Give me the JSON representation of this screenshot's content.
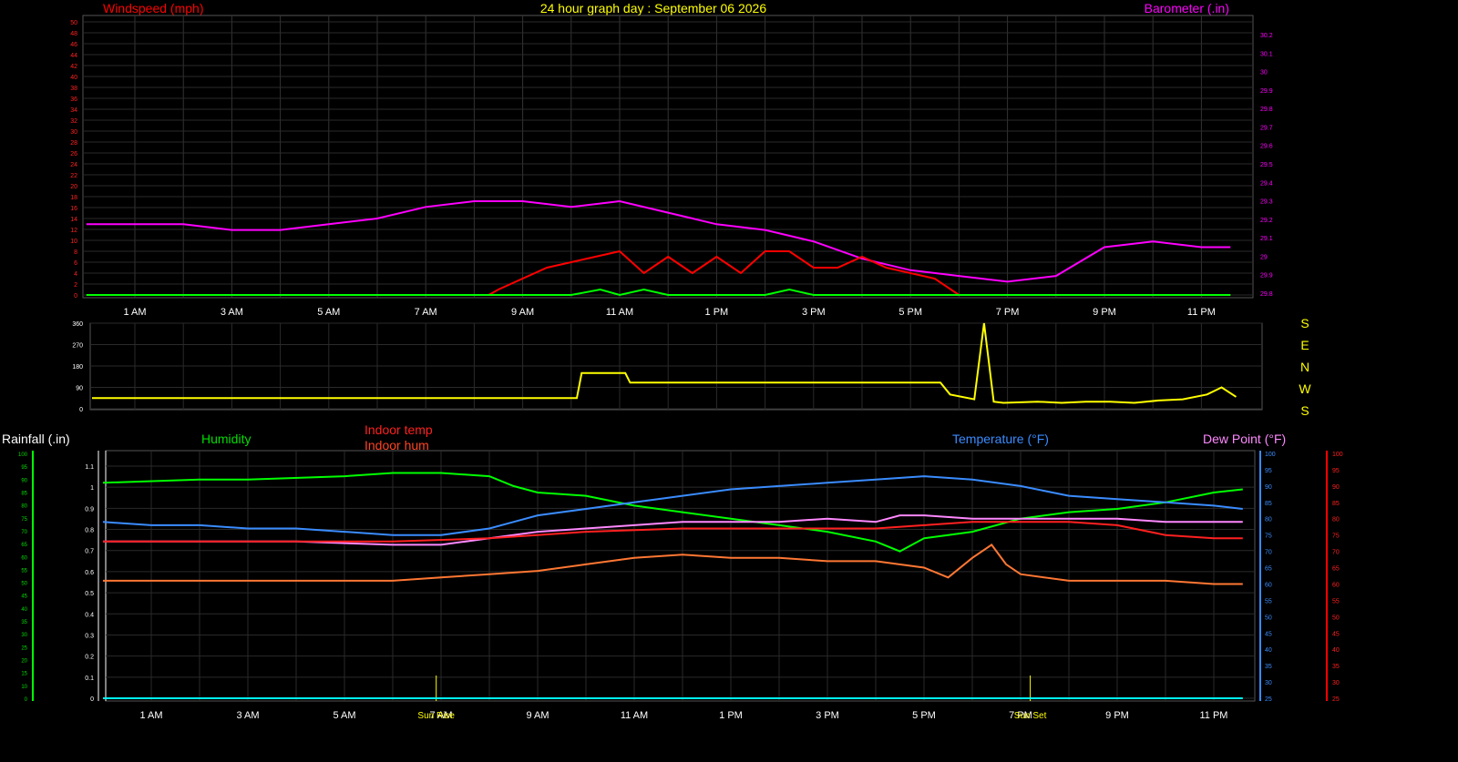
{
  "chart_data": [
    {
      "type": "line",
      "title": "24 hour graph day : September 06 2026",
      "left_axis_label": "Windspeed (mph)",
      "right_axis_label": "Barometer (.in)",
      "x_tick_labels": [
        "1 AM",
        "3 AM",
        "5 AM",
        "7 AM",
        "9 AM",
        "11 AM",
        "1 PM",
        "3 PM",
        "5 PM",
        "7 PM",
        "9 PM",
        "11 PM"
      ],
      "x_range_hours": [
        0,
        23.6
      ],
      "ylim_left": [
        0,
        50
      ],
      "ylim_right": [
        29.8,
        30.25
      ],
      "left_ticks": [
        "0",
        "2",
        "4",
        "6",
        "8",
        "10",
        "12",
        "14",
        "16",
        "18",
        "20",
        "22",
        "24",
        "26",
        "28",
        "30",
        "32",
        "34",
        "36",
        "38",
        "40",
        "42",
        "44",
        "46",
        "48",
        "50"
      ],
      "right_ticks": [
        "29.8",
        "29.9",
        "29",
        "29.1",
        "29.2",
        "29.3",
        "29.4",
        "29.5",
        "29.6",
        "29.7",
        "29.8",
        "29.9",
        "30",
        "30.1",
        "30.2"
      ],
      "series": [
        {
          "name": "Barometer (.in)",
          "axis": "right",
          "color": "#ff00ff",
          "x": [
            0,
            1,
            2,
            3,
            4,
            5,
            6,
            7,
            8,
            9,
            10,
            11,
            12,
            13,
            14,
            15,
            16,
            17,
            18,
            19,
            20,
            21,
            22,
            23,
            23.6
          ],
          "values": [
            29.92,
            29.92,
            29.92,
            29.91,
            29.91,
            29.92,
            29.93,
            29.95,
            29.96,
            29.96,
            29.95,
            29.96,
            29.94,
            29.92,
            29.91,
            29.89,
            29.86,
            29.84,
            29.83,
            29.82,
            29.83,
            29.88,
            29.89,
            29.88,
            29.88
          ]
        },
        {
          "name": "Windspeed (mph)",
          "axis": "left",
          "color": "#ff0000",
          "x": [
            0,
            8.3,
            8.5,
            9.5,
            10,
            10.5,
            11,
            11.5,
            12,
            12.5,
            13,
            13.5,
            14,
            14.5,
            15,
            15.5,
            16,
            16.5,
            17,
            17.5,
            18,
            19,
            20,
            21,
            22,
            23,
            23.6
          ],
          "values": [
            0,
            0,
            1,
            5,
            6,
            7,
            8,
            4,
            7,
            4,
            7,
            4,
            8,
            8,
            5,
            5,
            7,
            5,
            4,
            3,
            0,
            0,
            0,
            0,
            0,
            0,
            0
          ]
        },
        {
          "name": "Gust",
          "axis": "left",
          "color": "#00ff00",
          "x": [
            0,
            10,
            10.6,
            11,
            11.5,
            12,
            14,
            14.5,
            15,
            23.6
          ],
          "values": [
            0,
            0,
            1,
            0,
            1,
            0,
            0,
            1,
            0,
            0
          ]
        }
      ]
    },
    {
      "type": "line",
      "title": "",
      "ylim": [
        0,
        360
      ],
      "y_ticks": [
        "0",
        "90",
        "180",
        "270",
        "360"
      ],
      "direction_labels": [
        "S",
        "E",
        "N",
        "W",
        "S"
      ],
      "series": [
        {
          "name": "Wind direction",
          "color": "#ffff00",
          "x": [
            0,
            10,
            10.1,
            11,
            11.1,
            17.5,
            17.7,
            18.2,
            18.4,
            18.6,
            18.8,
            19.5,
            20,
            20.5,
            21,
            21.5,
            22,
            22.5,
            23,
            23.3,
            23.6
          ],
          "values": [
            45,
            45,
            150,
            150,
            110,
            110,
            60,
            40,
            360,
            30,
            25,
            30,
            25,
            30,
            30,
            25,
            35,
            40,
            60,
            90,
            50
          ]
        }
      ]
    },
    {
      "type": "line",
      "title": "",
      "x_tick_labels": [
        "1 AM",
        "3 AM",
        "5 AM",
        "7 AM",
        "9 AM",
        "11 AM",
        "1 PM",
        "3 PM",
        "5 PM",
        "7 PM",
        "9 PM",
        "11 PM"
      ],
      "sun_markers": [
        "Sun Rise",
        "Sun Set"
      ],
      "axis_labels": {
        "rainfall": "Rainfall (.in)",
        "humidity": "Humidity",
        "indoor_temp": "Indoor temp",
        "indoor_hum": "Indoor hum",
        "temperature": "Temperature (°F)",
        "dew_point": "Dew Point (°F)"
      },
      "rain_ticks": [
        "0",
        "0.1",
        "0.2",
        "0.3",
        "0.4",
        "0.5",
        "0.6",
        "0.7",
        "0.8",
        "0.9",
        "1",
        "1.1"
      ],
      "humidity_ticks": [
        "0",
        "10",
        "15",
        "20",
        "25",
        "30",
        "35",
        "40",
        "45",
        "50",
        "55",
        "60",
        "65",
        "70",
        "75",
        "80",
        "85",
        "90",
        "95",
        "100"
      ],
      "temp_ticks": [
        "25",
        "30",
        "35",
        "40",
        "45",
        "50",
        "55",
        "60",
        "65",
        "70",
        "75",
        "80",
        "85",
        "90",
        "95",
        "100"
      ],
      "indoor_ticks": [
        "25",
        "30",
        "35",
        "40",
        "45",
        "50",
        "55",
        "60",
        "65",
        "70",
        "75",
        "80",
        "85",
        "90",
        "95",
        "100"
      ],
      "temp_range": [
        25,
        100
      ],
      "series": [
        {
          "name": "Humidity",
          "color": "#00ff00",
          "x": [
            0,
            2,
            3,
            5,
            6,
            7,
            8,
            8.5,
            9,
            10,
            11,
            12,
            13,
            14,
            15,
            16,
            16.5,
            17,
            17.5,
            18,
            19,
            20,
            21,
            22,
            23,
            23.6
          ],
          "values": [
            91,
            92,
            92,
            93,
            94,
            94,
            93,
            90,
            88,
            87,
            84,
            82,
            80,
            78,
            76,
            73,
            70,
            74,
            75,
            76,
            80,
            82,
            83,
            85,
            88,
            89
          ]
        },
        {
          "name": "Temperature (°F)",
          "color": "#3a8cff",
          "x": [
            0,
            1,
            2,
            3,
            4,
            5,
            6,
            7,
            8,
            8.5,
            9,
            10,
            11,
            12,
            13,
            14,
            15,
            16,
            17,
            18,
            19,
            20,
            21,
            22,
            23,
            23.6
          ],
          "values": [
            79,
            78,
            78,
            77,
            77,
            76,
            75,
            75,
            77,
            79,
            81,
            83,
            85,
            87,
            89,
            90,
            91,
            92,
            93,
            92,
            90,
            87,
            86,
            85,
            84,
            83
          ]
        },
        {
          "name": "Dew Point (°F)",
          "color": "#ff88ff",
          "x": [
            0,
            2,
            4,
            6,
            7,
            8,
            9,
            10,
            11,
            12,
            13,
            14,
            15,
            16,
            16.5,
            17,
            18,
            19,
            20,
            21,
            22,
            23,
            23.6
          ],
          "values": [
            73,
            73,
            73,
            72,
            72,
            74,
            76,
            77,
            78,
            79,
            79,
            79,
            80,
            79,
            81,
            81,
            80,
            80,
            80,
            80,
            79,
            79,
            79
          ]
        },
        {
          "name": "Indoor temp",
          "color": "#ff2020",
          "x": [
            0,
            3,
            6,
            8,
            10,
            12,
            14,
            16,
            17,
            18,
            19,
            20,
            21,
            22,
            23,
            23.6
          ],
          "values": [
            73,
            73,
            73,
            74,
            76,
            77,
            77,
            77,
            78,
            79,
            79,
            79,
            78,
            75,
            74,
            74
          ]
        },
        {
          "name": "Indoor hum",
          "color": "#ff7733",
          "x": [
            0,
            2,
            4,
            6,
            7,
            8,
            9,
            10,
            11,
            12,
            13,
            14,
            15,
            16,
            17,
            17.5,
            18,
            18.4,
            18.7,
            19,
            20,
            21,
            22,
            23,
            23.6
          ],
          "values": [
            61,
            61,
            61,
            61,
            62,
            63,
            64,
            66,
            68,
            69,
            68,
            68,
            67,
            67,
            65,
            62,
            68,
            72,
            66,
            63,
            61,
            61,
            61,
            60,
            60
          ]
        },
        {
          "name": "Rainfall (.in)",
          "color": "#00ffff",
          "x": [
            0,
            23.6
          ],
          "values": [
            0,
            0
          ]
        }
      ]
    }
  ]
}
